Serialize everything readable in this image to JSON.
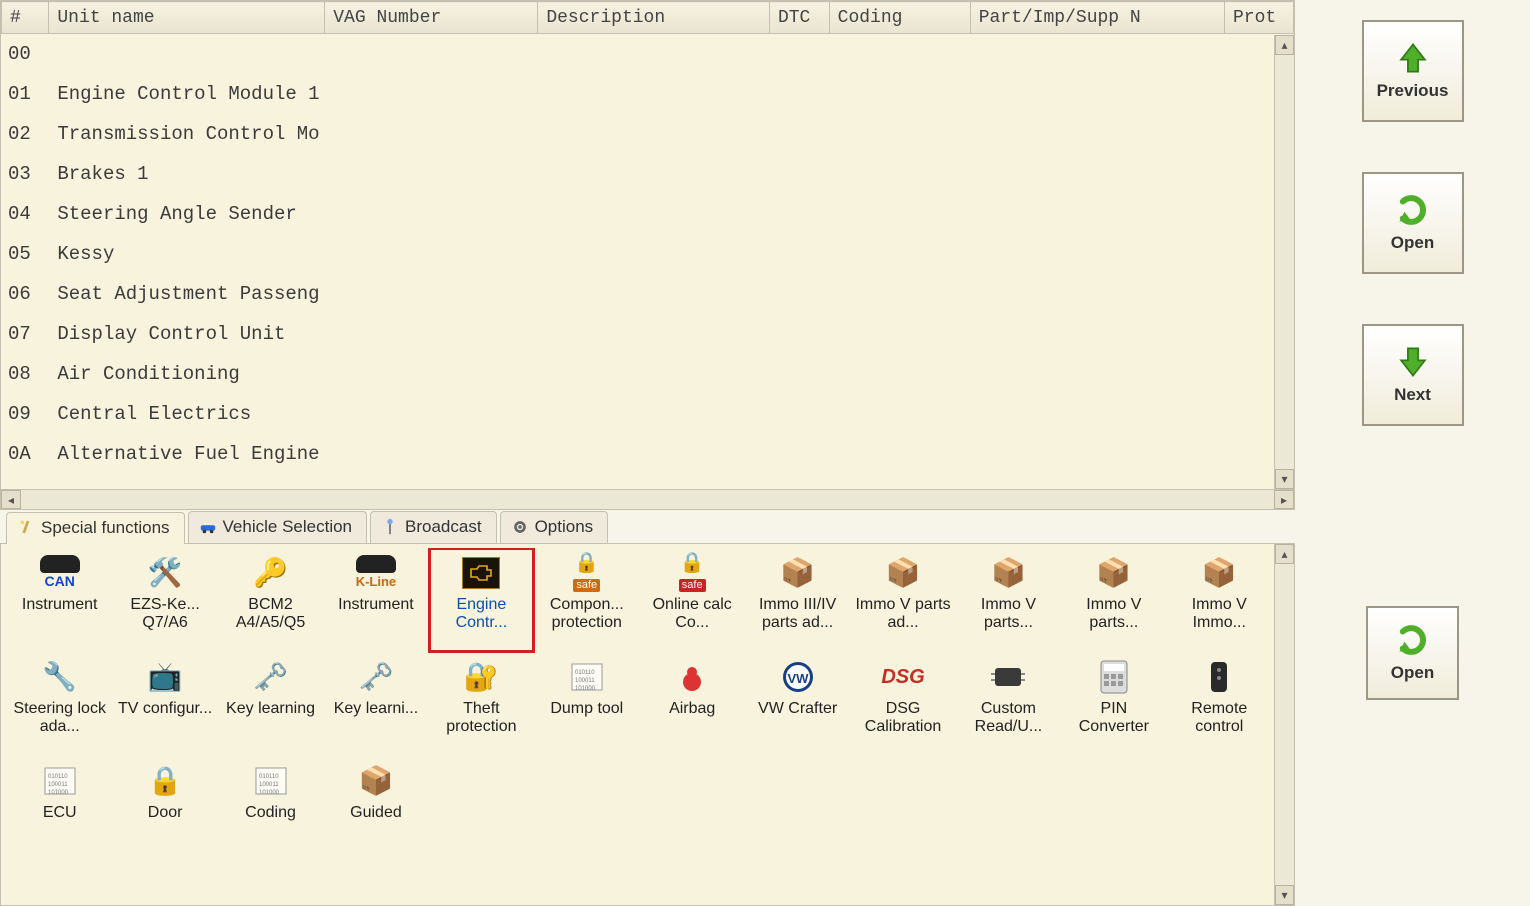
{
  "columns": [
    "#",
    "Unit name",
    "VAG Number",
    "Description",
    "DTC",
    "Coding",
    "Part/Imp/Supp N",
    "Prot"
  ],
  "rows": [
    {
      "idx": "00",
      "name": ""
    },
    {
      "idx": "01",
      "name": "Engine Control Module 1"
    },
    {
      "idx": "02",
      "name": "Transmission Control Mo..."
    },
    {
      "idx": "03",
      "name": "Brakes 1"
    },
    {
      "idx": "04",
      "name": "Steering Angle Sender"
    },
    {
      "idx": "05",
      "name": "Kessy"
    },
    {
      "idx": "06",
      "name": "Seat Adjustment Passeng..."
    },
    {
      "idx": "07",
      "name": "Display Control Unit"
    },
    {
      "idx": "08",
      "name": "Air Conditioning"
    },
    {
      "idx": "09",
      "name": "Central Electrics"
    },
    {
      "idx": "0A",
      "name": "Alternative Fuel Engine"
    }
  ],
  "sidebar": {
    "previous": "Previous",
    "open": "Open",
    "next": "Next",
    "open2": "Open"
  },
  "tabs": [
    {
      "label": "Special functions",
      "active": true,
      "icon": "wand"
    },
    {
      "label": "Vehicle Selection",
      "active": false,
      "icon": "car"
    },
    {
      "label": "Broadcast",
      "active": false,
      "icon": "antenna"
    },
    {
      "label": "Options",
      "active": false,
      "icon": "gear"
    }
  ],
  "functions": [
    {
      "label": "Instrument",
      "icon": "can"
    },
    {
      "label": "EZS-Ke... Q7/A6",
      "icon": "wrenchkey"
    },
    {
      "label": "BCM2 A4/A5/Q5",
      "icon": "key"
    },
    {
      "label": "Instrument",
      "icon": "kline"
    },
    {
      "label": "Engine Contr...",
      "icon": "engine",
      "selected": true
    },
    {
      "label": "Compon... protection",
      "icon": "locksafe"
    },
    {
      "label": "Online calc Co...",
      "icon": "locksafe2"
    },
    {
      "label": "Immo III/IV parts ad...",
      "icon": "box"
    },
    {
      "label": "Immo V parts ad...",
      "icon": "box"
    },
    {
      "label": "Immo V parts...",
      "icon": "box"
    },
    {
      "label": "Immo V parts...",
      "icon": "box"
    },
    {
      "label": "Immo V Immo...",
      "icon": "box"
    },
    {
      "label": "Steering lock ada...",
      "icon": "tools"
    },
    {
      "label": "TV configur...",
      "icon": "tv"
    },
    {
      "label": "Key learning",
      "icon": "keyglow"
    },
    {
      "label": "Key learni...",
      "icon": "keyglow"
    },
    {
      "label": "Theft protection",
      "icon": "lockkey"
    },
    {
      "label": "Dump tool",
      "icon": "hex"
    },
    {
      "label": "Airbag",
      "icon": "airbag"
    },
    {
      "label": "VW Crafter",
      "icon": "vw"
    },
    {
      "label": "DSG Calibration",
      "icon": "dsg"
    },
    {
      "label": "Custom Read/U...",
      "icon": "chip"
    },
    {
      "label": "PIN Converter",
      "icon": "calc"
    },
    {
      "label": "Remote control",
      "icon": "remote"
    },
    {
      "label": "ECU",
      "icon": "hex"
    },
    {
      "label": "Door",
      "icon": "lock"
    },
    {
      "label": "Coding",
      "icon": "hex"
    },
    {
      "label": "Guided",
      "icon": "box"
    }
  ]
}
